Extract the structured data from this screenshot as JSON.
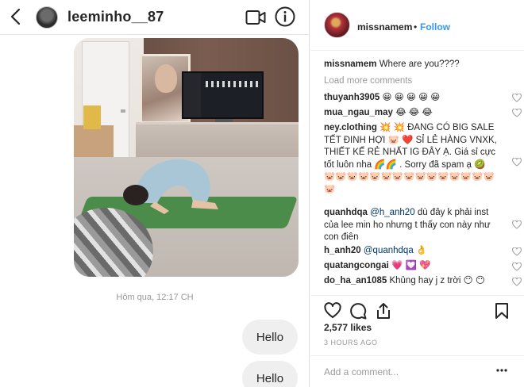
{
  "dm": {
    "username": "leeminho__87",
    "timestamp": "Hôm qua, 12:17 CH",
    "messages": [
      "Hello",
      "Hello"
    ]
  },
  "post": {
    "username": "missnamem",
    "separator": "•",
    "follow_label": "Follow",
    "caption": "Where are you????",
    "load_more": "Load more comments",
    "comments": [
      {
        "user": "thuyanh3905",
        "text": "😀 😀 😀 😀 😀"
      },
      {
        "user": "mua_ngau_may",
        "text": "😂 😂 😂"
      },
      {
        "user": "ney.clothing",
        "text": "💥 💥  ĐANG CÓ BIG SALE TẾT ĐINH HỢI 🐷 ❤️  SỈ LẺ HÀNG VNXK, THIẾT KẾ RẺ NHẤT IG ĐÂY Ạ. Giá sỉ cực tốt luôn nha 🌈🌈 . Sorry đã spam ạ 🥝 🐷🐷🐷🐷🐷🐷🐷🐷🐷🐷🐷🐷🐷🐷🐷🐷"
      },
      {
        "user": "quanhdqa",
        "mention": "@h_anh20",
        "text": "dù đây k phải inst của lee min ho nhưng t thấy con này như con điên"
      },
      {
        "user": "h_anh20",
        "mention": "@quanhdqa",
        "text": "👌"
      },
      {
        "user": "quatangcongai",
        "text": "💗 💟 💖"
      },
      {
        "user": "do_ha_an1085",
        "text": "Khủng hay j z trời 😶 😶"
      }
    ],
    "likes": "2,577 likes",
    "posted_ago": "3 HOURS AGO",
    "comment_placeholder": "Add a comment...",
    "colors": {
      "link": "#3897f0",
      "mention": "#003569",
      "secondary": "#999999"
    }
  }
}
